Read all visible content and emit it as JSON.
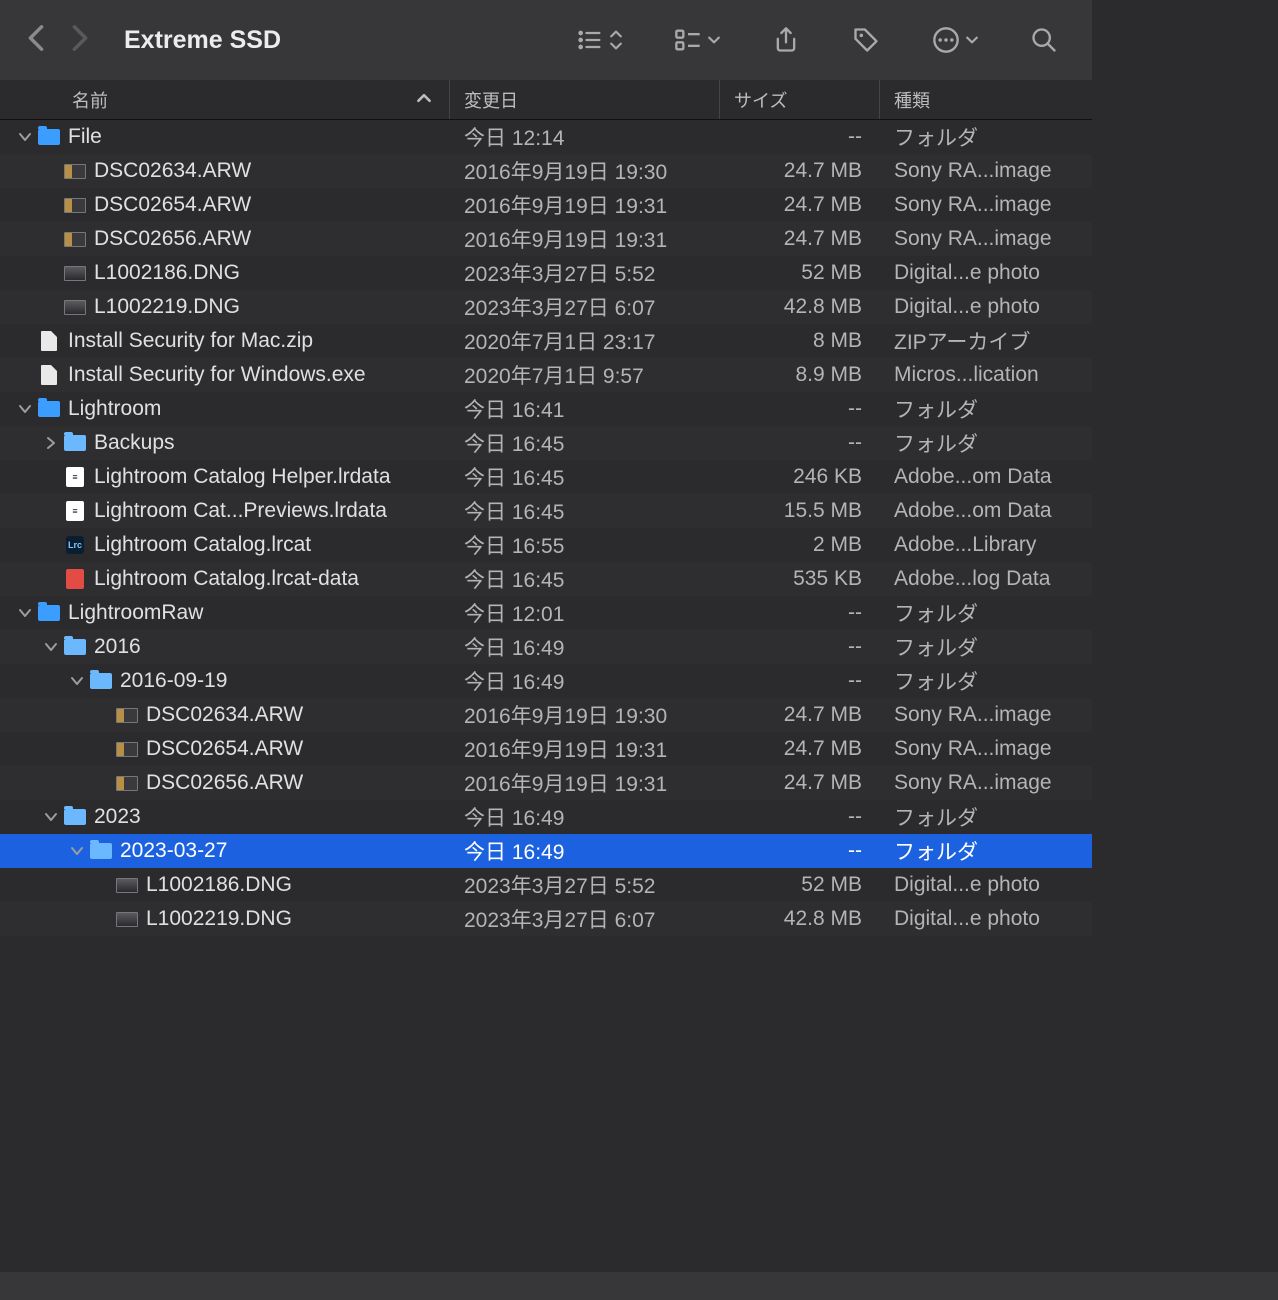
{
  "title": "Extreme SSD",
  "columns": {
    "name": "名前",
    "date": "変更日",
    "size": "サイズ",
    "kind": "種類"
  },
  "rows": [
    {
      "depth": 0,
      "disc": "down",
      "icon": "folder",
      "name": "File",
      "date": "今日 12:14",
      "size": "--",
      "kind": "フォルダ"
    },
    {
      "depth": 1,
      "icon": "arw",
      "name": "DSC02634.ARW",
      "date": "2016年9月19日 19:30",
      "size": "24.7 MB",
      "kind": "Sony RA...image"
    },
    {
      "depth": 1,
      "icon": "arw",
      "name": "DSC02654.ARW",
      "date": "2016年9月19日 19:31",
      "size": "24.7 MB",
      "kind": "Sony RA...image"
    },
    {
      "depth": 1,
      "icon": "arw",
      "name": "DSC02656.ARW",
      "date": "2016年9月19日 19:31",
      "size": "24.7 MB",
      "kind": "Sony RA...image"
    },
    {
      "depth": 1,
      "icon": "thumb",
      "name": "L1002186.DNG",
      "date": "2023年3月27日 5:52",
      "size": "52 MB",
      "kind": "Digital...e photo"
    },
    {
      "depth": 1,
      "icon": "thumb",
      "name": "L1002219.DNG",
      "date": "2023年3月27日 6:07",
      "size": "42.8 MB",
      "kind": "Digital...e photo"
    },
    {
      "depth": 0,
      "icon": "doc",
      "name": "Install Security for Mac.zip",
      "date": "2020年7月1日 23:17",
      "size": "8 MB",
      "kind": "ZIPアーカイブ"
    },
    {
      "depth": 0,
      "icon": "doc",
      "name": "Install Security for Windows.exe",
      "date": "2020年7月1日 9:57",
      "size": "8.9 MB",
      "kind": "Micros...lication"
    },
    {
      "depth": 0,
      "disc": "down",
      "icon": "folder",
      "name": "Lightroom",
      "date": "今日 16:41",
      "size": "--",
      "kind": "フォルダ"
    },
    {
      "depth": 1,
      "disc": "right",
      "icon": "folder-lite",
      "name": "Backups",
      "date": "今日 16:45",
      "size": "--",
      "kind": "フォルダ"
    },
    {
      "depth": 1,
      "icon": "lrdoc",
      "name": "Lightroom Catalog Helper.lrdata",
      "date": "今日 16:45",
      "size": "246 KB",
      "kind": "Adobe...om Data"
    },
    {
      "depth": 1,
      "icon": "lrdoc",
      "name": "Lightroom Cat...Previews.lrdata",
      "date": "今日 16:45",
      "size": "15.5 MB",
      "kind": "Adobe...om Data"
    },
    {
      "depth": 1,
      "icon": "lrc",
      "name": "Lightroom Catalog.lrcat",
      "date": "今日 16:55",
      "size": "2 MB",
      "kind": "Adobe...Library"
    },
    {
      "depth": 1,
      "icon": "red",
      "name": "Lightroom Catalog.lrcat-data",
      "date": "今日 16:45",
      "size": "535 KB",
      "kind": "Adobe...log Data"
    },
    {
      "depth": 0,
      "disc": "down",
      "icon": "folder",
      "name": "LightroomRaw",
      "date": "今日 12:01",
      "size": "--",
      "kind": "フォルダ"
    },
    {
      "depth": 1,
      "disc": "down",
      "icon": "folder-lite",
      "name": "2016",
      "date": "今日 16:49",
      "size": "--",
      "kind": "フォルダ"
    },
    {
      "depth": 2,
      "disc": "down",
      "icon": "folder-lite",
      "name": "2016-09-19",
      "date": "今日 16:49",
      "size": "--",
      "kind": "フォルダ"
    },
    {
      "depth": 3,
      "icon": "arw",
      "name": "DSC02634.ARW",
      "date": "2016年9月19日 19:30",
      "size": "24.7 MB",
      "kind": "Sony RA...image"
    },
    {
      "depth": 3,
      "icon": "arw",
      "name": "DSC02654.ARW",
      "date": "2016年9月19日 19:31",
      "size": "24.7 MB",
      "kind": "Sony RA...image"
    },
    {
      "depth": 3,
      "icon": "arw",
      "name": "DSC02656.ARW",
      "date": "2016年9月19日 19:31",
      "size": "24.7 MB",
      "kind": "Sony RA...image"
    },
    {
      "depth": 1,
      "disc": "down",
      "icon": "folder-lite",
      "name": "2023",
      "date": "今日 16:49",
      "size": "--",
      "kind": "フォルダ"
    },
    {
      "depth": 2,
      "disc": "down",
      "icon": "folder-lite",
      "name": "2023-03-27",
      "date": "今日 16:49",
      "size": "--",
      "kind": "フォルダ",
      "selected": true
    },
    {
      "depth": 3,
      "icon": "thumb",
      "name": "L1002186.DNG",
      "date": "2023年3月27日 5:52",
      "size": "52 MB",
      "kind": "Digital...e photo"
    },
    {
      "depth": 3,
      "icon": "thumb",
      "name": "L1002219.DNG",
      "date": "2023年3月27日 6:07",
      "size": "42.8 MB",
      "kind": "Digital...e photo"
    }
  ]
}
